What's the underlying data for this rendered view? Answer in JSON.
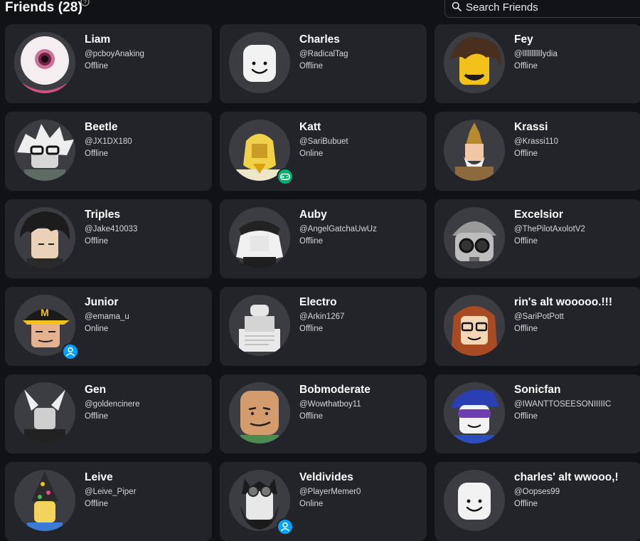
{
  "header": {
    "title": "Friends (28)",
    "search_placeholder": "Search Friends",
    "icons": [
      "help-icon",
      "search-icon"
    ]
  },
  "friends": [
    {
      "name": "Liam",
      "username": "@pcboyAnaking",
      "status": "Offline",
      "avatar": "eyeball"
    },
    {
      "name": "Charles",
      "username": "@RadicalTag",
      "status": "Offline",
      "avatar": "classic"
    },
    {
      "name": "Fey",
      "username": "@lllllllllllydia",
      "status": "Offline",
      "avatar": "brownhair"
    },
    {
      "name": "Beetle",
      "username": "@JX1DX180",
      "status": "Offline",
      "avatar": "whitehair"
    },
    {
      "name": "Katt",
      "username": "@SariBubuet",
      "status": "Online",
      "avatar": "blonde",
      "presence": "in-game"
    },
    {
      "name": "Krassi",
      "username": "@Krassi110",
      "status": "Offline",
      "avatar": "warrior"
    },
    {
      "name": "Triples",
      "username": "@Jake410033",
      "status": "Offline",
      "avatar": "darkhair"
    },
    {
      "name": "Auby",
      "username": "@AngelGatchaUwUz",
      "status": "Offline",
      "avatar": "whitehood"
    },
    {
      "name": "Excelsior",
      "username": "@ThePilotAxolotV2",
      "status": "Offline",
      "avatar": "beanie"
    },
    {
      "name": "Junior",
      "username": "@emama_u",
      "status": "Online",
      "avatar": "cap",
      "presence": "online"
    },
    {
      "name": "Electro",
      "username": "@Arkin1267",
      "status": "Offline",
      "avatar": "paper"
    },
    {
      "name": "rin's alt wooooo.!!!",
      "username": "@SariPotPott",
      "status": "Offline",
      "avatar": "redhair"
    },
    {
      "name": "Gen",
      "username": "@goldencinere",
      "status": "Offline",
      "avatar": "horns"
    },
    {
      "name": "Bobmoderate",
      "username": "@Wowthatboy11",
      "status": "Offline",
      "avatar": "bald"
    },
    {
      "name": "Sonicfan",
      "username": "@IWANTTOSEESONIIIIIC",
      "status": "Offline",
      "avatar": "bluehair"
    },
    {
      "name": "Leive",
      "username": "@Leive_Piper",
      "status": "Offline",
      "avatar": "witch"
    },
    {
      "name": "Veldivides",
      "username": "@PlayerMemer0",
      "status": "Online",
      "avatar": "goggles",
      "presence": "online"
    },
    {
      "name": "charles' alt wwooo,!",
      "username": "@Oopses99",
      "status": "Offline",
      "avatar": "classic"
    }
  ],
  "colors": {
    "background": "#111216",
    "card": "#232429",
    "online": "#00a2ff",
    "in_game": "#00b06f"
  }
}
